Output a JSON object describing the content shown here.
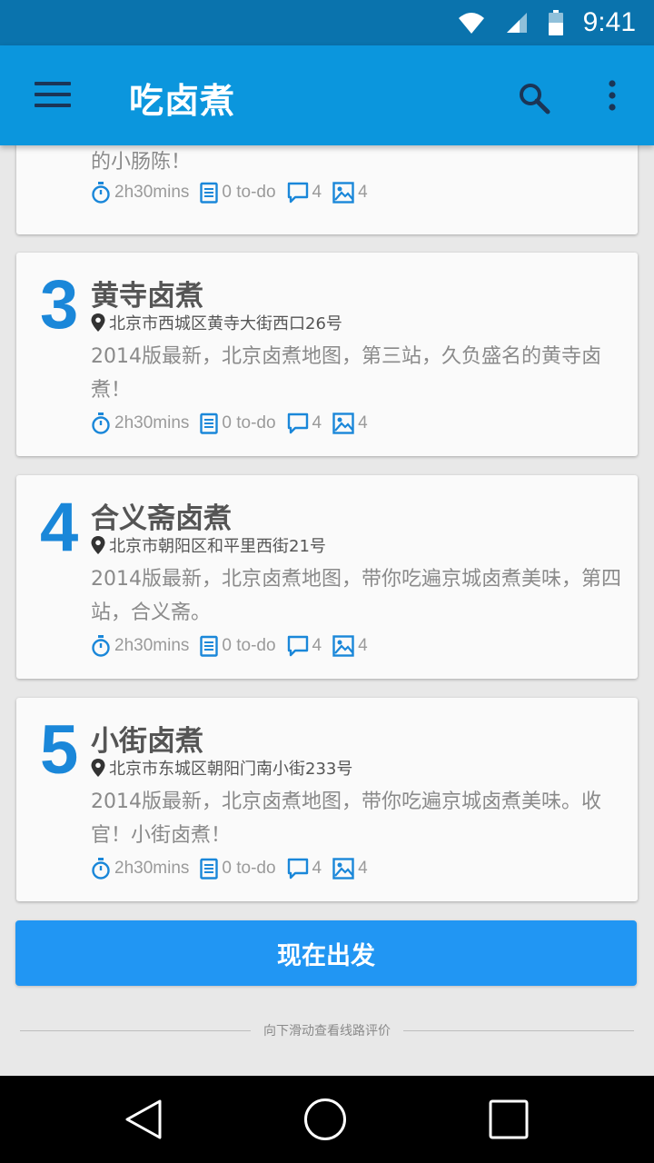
{
  "status_bar": {
    "time": "9:41"
  },
  "app_bar": {
    "title": "吃卤煮"
  },
  "partial_card": {
    "desc_tail": "的小肠陈！",
    "meta": {
      "time": "2h30mins",
      "todo": "0 to-do",
      "comments": "4",
      "photos": "4"
    }
  },
  "cards": [
    {
      "number": "3",
      "name": "黄寺卤煮",
      "address": "北京市西城区黄寺大街西口26号",
      "description": "2014版最新，北京卤煮地图，第三站，久负盛名的黄寺卤煮！",
      "meta": {
        "time": "2h30mins",
        "todo": "0 to-do",
        "comments": "4",
        "photos": "4"
      }
    },
    {
      "number": "4",
      "name": "合义斋卤煮",
      "address": "北京市朝阳区和平里西街21号",
      "description": "2014版最新，北京卤煮地图，带你吃遍京城卤煮美味，第四站，合义斋。",
      "meta": {
        "time": "2h30mins",
        "todo": "0 to-do",
        "comments": "4",
        "photos": "4"
      }
    },
    {
      "number": "5",
      "name": "小街卤煮",
      "address": "北京市东城区朝阳门南小街233号",
      "description": "2014版最新，北京卤煮地图，带你吃遍京城卤煮美味。收官！小街卤煮！",
      "meta": {
        "time": "2h30mins",
        "todo": "0 to-do",
        "comments": "4",
        "photos": "4"
      }
    }
  ],
  "action": {
    "go_label": "现在出发"
  },
  "footer": {
    "hint": "向下滑动查看线路评价"
  },
  "icons": {
    "status": [
      "wifi-icon",
      "signal-icon",
      "battery-icon"
    ],
    "app_bar": [
      "menu-icon",
      "search-icon",
      "more-vert-icon"
    ],
    "meta": [
      "timer-icon",
      "todo-list-icon",
      "comment-icon",
      "photo-icon"
    ],
    "address": "location-pin-icon",
    "nav": [
      "back-icon",
      "home-icon",
      "recents-icon"
    ]
  },
  "colors": {
    "status_bar": "#0a73ad",
    "app_bar": "#0b96dd",
    "accent": "#1a87d9",
    "button": "#2196f3"
  }
}
